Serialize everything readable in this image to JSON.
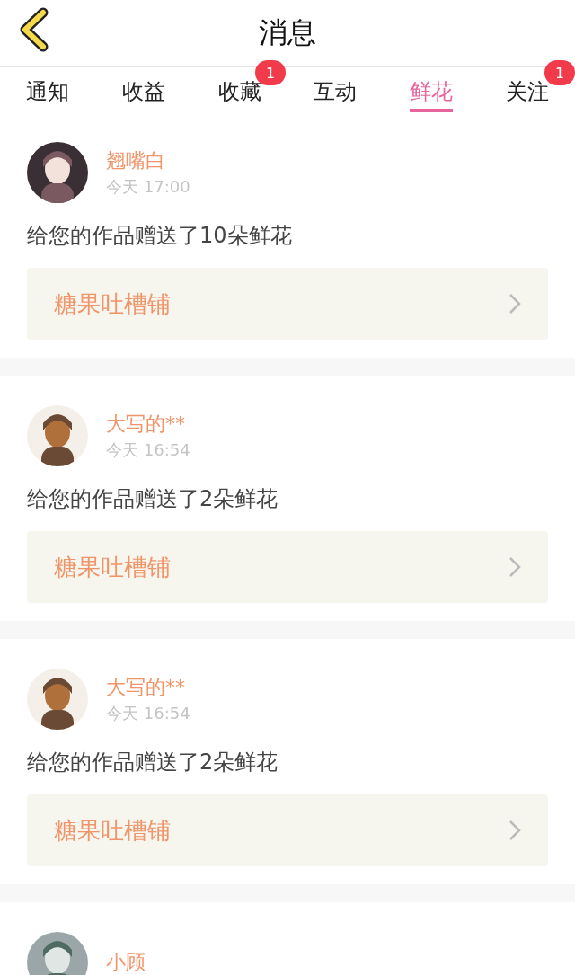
{
  "header": {
    "title": "消息"
  },
  "tabs": [
    {
      "label": "通知",
      "selected": false
    },
    {
      "label": "收益",
      "selected": false
    },
    {
      "label": "收藏",
      "selected": false,
      "badge": "1"
    },
    {
      "label": "互动",
      "selected": false
    },
    {
      "label": "鲜花",
      "selected": true
    },
    {
      "label": "关注",
      "selected": false,
      "badge": "1"
    }
  ],
  "messages": [
    {
      "name": "翘嘴白",
      "time": "今天 17:00",
      "text": "给您的作品赠送了10朵鲜花",
      "work": "糖果吐槽铺"
    },
    {
      "name": "大写的**",
      "time": "今天 16:54",
      "text": "给您的作品赠送了2朵鲜花",
      "work": "糖果吐槽铺"
    },
    {
      "name": "大写的**",
      "time": "今天 16:54",
      "text": "给您的作品赠送了2朵鲜花",
      "work": "糖果吐槽铺"
    },
    {
      "name": "小顾"
    }
  ]
}
